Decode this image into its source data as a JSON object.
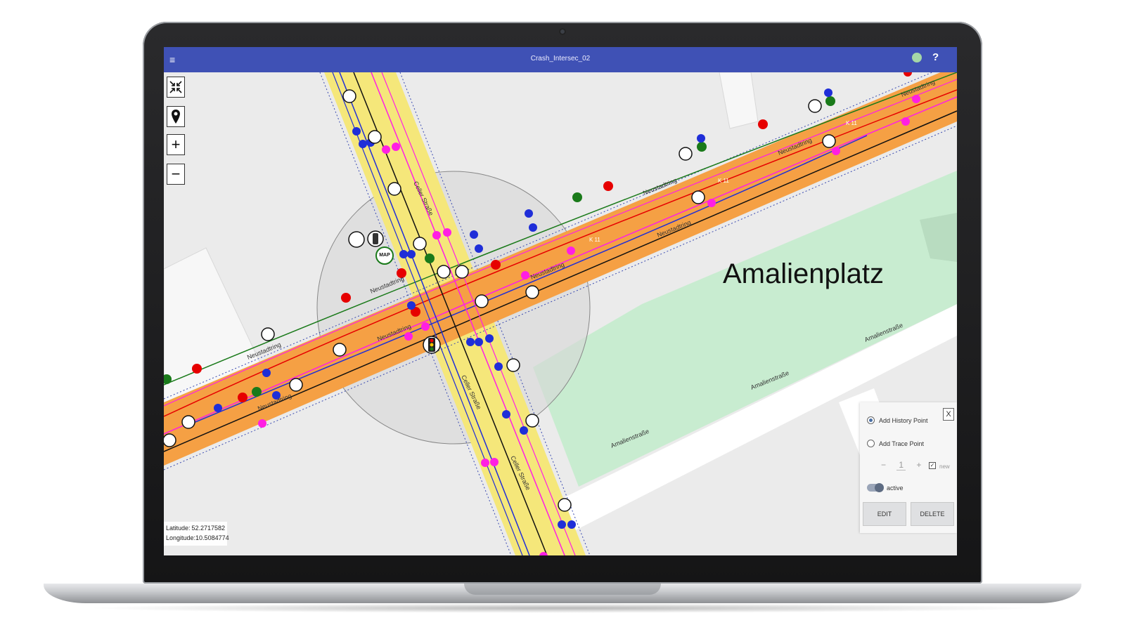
{
  "window": {
    "title": "Crash_Intersec_02",
    "menu_glyph": "≡",
    "help_glyph": "?"
  },
  "map": {
    "place_label": "Amalienplatz",
    "street_labels": {
      "neustadtring": "Neustadtring",
      "celler": "Celler Straße",
      "amalien": "Amalienstraße",
      "k11": "K 11"
    },
    "marker_labels": {
      "map_badge": "MAP"
    },
    "colors": {
      "road_main": "#f5a044",
      "road_cross": "#f5e77a",
      "park": "#c8ecd0",
      "lane_blue": "#1f2ed8",
      "lane_magenta": "#ff1fe3",
      "lane_red": "#e60000",
      "lane_green": "#1a7a1a"
    }
  },
  "tools": {
    "fit_icon": "fit-extent-icon",
    "pin_icon": "location-pin-icon",
    "zoom_in": "+",
    "zoom_out": "−"
  },
  "coords": {
    "lat_label": "Latitude:",
    "lat_value": "52.2717582",
    "lon_label": "Longitude:",
    "lon_value": "10.5084774"
  },
  "panel": {
    "close": "X",
    "option1": "Add History Point",
    "option2": "Add Trace Point",
    "minus": "−",
    "step_value": "1",
    "plus": "+",
    "new_label": "new",
    "active_label": "active",
    "edit": "EDIT",
    "delete": "DELETE"
  }
}
